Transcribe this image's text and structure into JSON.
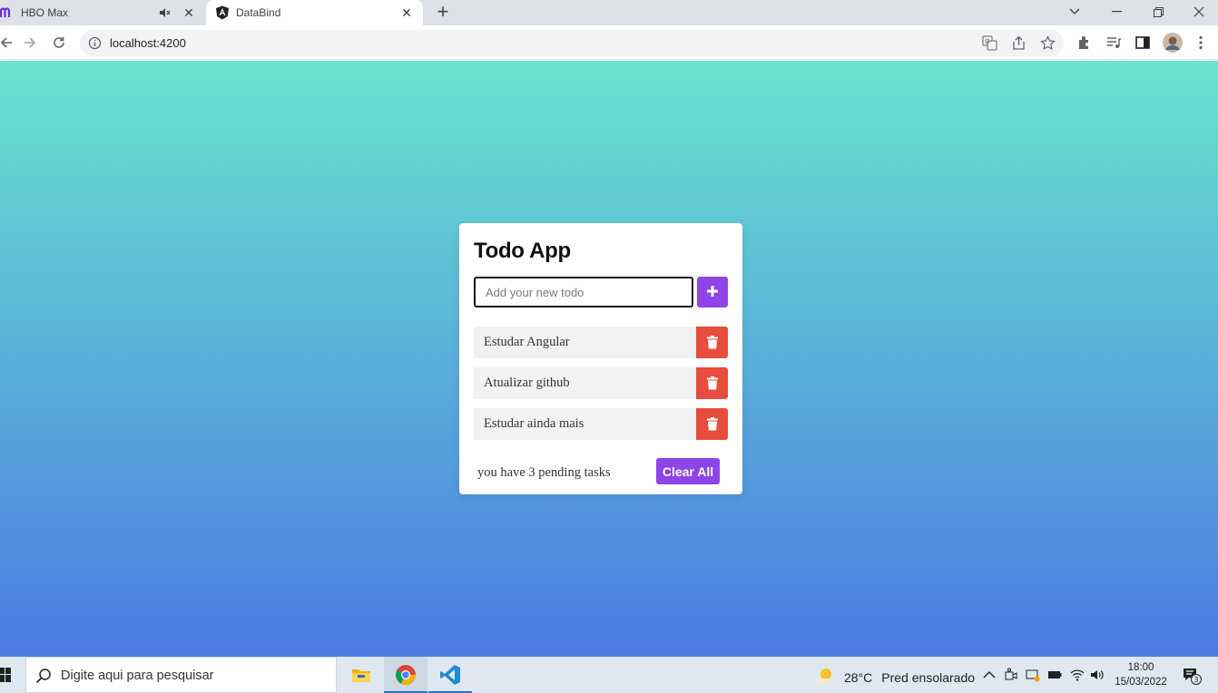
{
  "browser": {
    "tabs": [
      {
        "label": "HBO Max"
      },
      {
        "label": "DataBind"
      }
    ],
    "url": "localhost:4200"
  },
  "app": {
    "title": "Todo App",
    "input_placeholder": "Add your new todo",
    "todos": [
      {
        "text": "Estudar Angular"
      },
      {
        "text": "Atualizar github"
      },
      {
        "text": "Estudar ainda mais"
      }
    ],
    "pending_text": "you have 3 pending tasks",
    "clear_label": "Clear All",
    "colors": {
      "accent": "#8e44e6",
      "delete": "#e74c3c"
    }
  },
  "taskbar": {
    "search_placeholder": "Digite aqui para pesquisar",
    "weather_temp": "28°C",
    "weather_desc": "Pred ensolarado",
    "time": "18:00",
    "date": "15/03/2022",
    "notification_count": "3"
  }
}
